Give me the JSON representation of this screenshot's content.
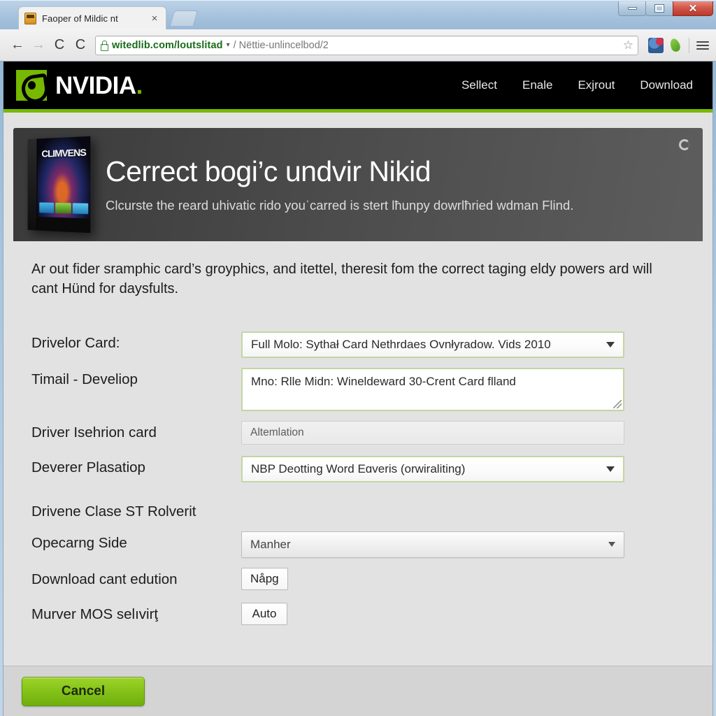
{
  "browser": {
    "tab": {
      "title": "Faoper of Mildic nt",
      "favicon_icon": "site-favicon",
      "close_icon": "×"
    },
    "nav": {
      "back_icon": "←",
      "forward_icon": "→",
      "reload_icon": "C",
      "reload2_icon": "C"
    },
    "omnibox": {
      "lock_icon": "lock-icon",
      "secure_text": "witedlib.com/loutslitad",
      "dropdown_caret": "▾",
      "rest_text": "/ Nëttie-unlincelbod/2",
      "star_icon": "☆"
    },
    "window": {
      "minimize": "–",
      "maximize": "□",
      "close": "✕"
    }
  },
  "site": {
    "brand": {
      "word": "NVIDIA",
      "dot": ".",
      "logo_icon": "nvidia-eye-logo"
    },
    "nav_links": [
      {
        "label": "Sellect"
      },
      {
        "label": "Enale"
      },
      {
        "label": "Exjrout"
      },
      {
        "label": "Download"
      }
    ],
    "accent_green": "#76b900"
  },
  "hero": {
    "title": "Cerrect bogi’c undvir Nikid",
    "subtitle": "Clcurste the reard uhivatic rido youˈcarred is stert lħunpy dowrlħried wdman Flind.",
    "boxart_title": "CLIMVENS",
    "spinner_icon": "loading-spinner-icon"
  },
  "content": {
    "intro": "Ar out fider sramphic card’s groyphics, and itettel, theresit fom the correct taging eldy powers ard will cant Hünd for daysfults."
  },
  "form": {
    "rows": [
      {
        "label": "Drivelor Card:",
        "value": "Full Molo: Sythał Card Nethrdaes Ovnłyradow. Vids 2010",
        "type": "select"
      },
      {
        "label": "Timail - Develiop",
        "value": "Mno: Rlle Midn: Wineldeward 30-Crent Card flland",
        "type": "textarea"
      },
      {
        "label": "Driver Isehrion card",
        "value": "Altemlation",
        "type": "disabled"
      },
      {
        "label": "Deverer Plasatiop",
        "value": "NBP Deotting Word Eɑveris (orwiraliting)",
        "type": "select"
      }
    ],
    "section_heading": "Drivene Clase ST Rolverit",
    "rows2": [
      {
        "label": "Opecarng Side",
        "value": "Manher",
        "type": "select-plain"
      },
      {
        "label": "Download cant edution",
        "value": "Nåpg",
        "type": "button"
      },
      {
        "label": "Murver MOS selıvirţ",
        "value": "Auto",
        "type": "button"
      }
    ]
  },
  "footer": {
    "cancel_label": "Cancel"
  }
}
